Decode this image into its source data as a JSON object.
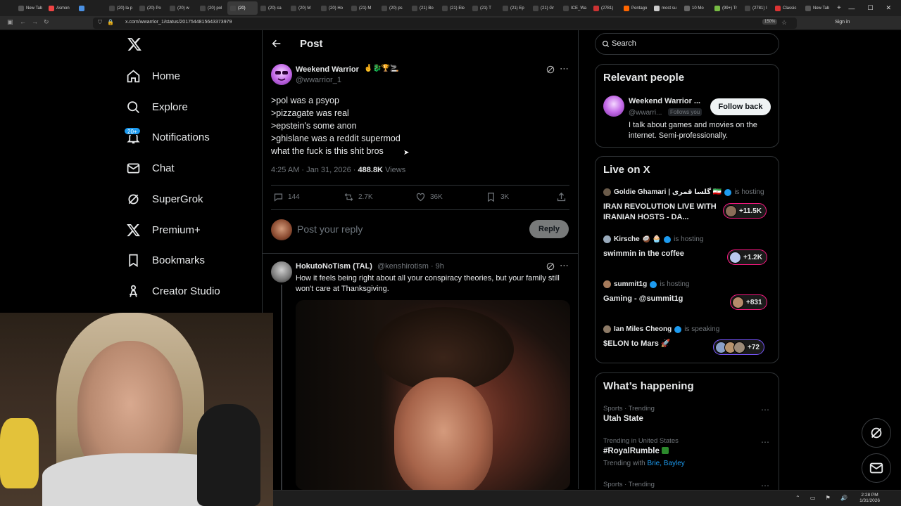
{
  "browser": {
    "tabs": [
      {
        "label": "New Tab"
      },
      {
        "label": "Asmon"
      },
      {
        "label": ""
      },
      {
        "label": "(20) la p"
      },
      {
        "label": "(20) Po"
      },
      {
        "label": "(20) w"
      },
      {
        "label": "(20) pol"
      },
      {
        "label": "(20)"
      },
      {
        "label": "(20) ca"
      },
      {
        "label": "(20) M"
      },
      {
        "label": "(20) Ho"
      },
      {
        "label": "(21) M"
      },
      {
        "label": "(20) ps"
      },
      {
        "label": "(21) Bo"
      },
      {
        "label": "(21) Ele"
      },
      {
        "label": "(21) T"
      },
      {
        "label": "(21) Ep"
      },
      {
        "label": "(21) Gr"
      },
      {
        "label": "ICE_Wa"
      },
      {
        "label": "(2781)"
      },
      {
        "label": "Pentago"
      },
      {
        "label": "most su"
      },
      {
        "label": "10 Mo"
      },
      {
        "label": "(99+) Tr"
      },
      {
        "label": "(2781) I"
      },
      {
        "label": "Classic"
      },
      {
        "label": "New Tab"
      }
    ],
    "active_tab_index": 7,
    "url": "x.com/wwarrior_1/status/2017544815643373979",
    "zoom": "150%",
    "sign_in": "Sign in"
  },
  "nav": {
    "items": [
      {
        "label": "Home",
        "icon": "home-icon"
      },
      {
        "label": "Explore",
        "icon": "search-icon"
      },
      {
        "label": "Notifications",
        "icon": "bell-icon"
      },
      {
        "label": "Chat",
        "icon": "mail-icon"
      },
      {
        "label": "SuperGrok",
        "icon": "grok-icon"
      },
      {
        "label": "Premium+",
        "icon": "x-logo-icon"
      },
      {
        "label": "Bookmarks",
        "icon": "bookmark-icon"
      },
      {
        "label": "Creator Studio",
        "icon": "creator-icon"
      }
    ],
    "notif_badge": "20+"
  },
  "post": {
    "header": "Post",
    "author_name": "Weekend Warrior",
    "author_emoji": "🤞🐉🏆🚬",
    "author_handle": "@wwarrior_1",
    "lines": [
      ">pol was a psyop",
      ">pizzagate was real",
      ">epstein's some anon",
      ">ghislane was a reddit supermod",
      "what the fuck is this shit bros"
    ],
    "time": "4:25 AM · Jan 31, 2026 · ",
    "views_count": "488.8K",
    "views_label": " Views",
    "actions": {
      "replies": "144",
      "reposts": "2.7K",
      "likes": "36K",
      "bookmarks": "3K"
    },
    "reply_placeholder": "Post your reply",
    "reply_button": "Reply"
  },
  "reply": {
    "name": "HokutoNoTism (TAL)",
    "handle": "@kenshirotism · 9h",
    "text": "How it feels being right about all your conspiracy theories, but your family still won't care at Thanksgiving."
  },
  "right": {
    "search_placeholder": "Search",
    "relevant": {
      "title": "Relevant people",
      "name": "Weekend Warrior ...",
      "handle": "@wwarri...",
      "follows_you": "Follows you",
      "follow_back": "Follow back",
      "bio": "I talk about games and movies on the internet. Semi-professionally."
    },
    "live": {
      "title": "Live on X",
      "items": [
        {
          "host": "Goldie Ghamari | گلسا قمری 🇮🇷",
          "status": "is hosting",
          "title": "IRAN REVOLUTION LIVE WITH IRANIAN HOSTS - DA...",
          "count": "+11.5K",
          "pill": "pink"
        },
        {
          "host": "Kirsche 🥥 🧁",
          "status": "is hosting",
          "title": "swimmin in the coffee",
          "count": "+1.2K",
          "pill": "pink"
        },
        {
          "host": "summit1g",
          "status": "is hosting",
          "title": "Gaming - @summit1g",
          "count": "+831",
          "pill": "pink"
        },
        {
          "host": "Ian Miles Cheong",
          "status": "is speaking",
          "title": "$ELON to Mars 🚀",
          "count": "+72",
          "pill": "purple"
        }
      ]
    },
    "happening": {
      "title": "What’s happening",
      "trends": [
        {
          "meta": "Sports · Trending",
          "name": "Utah State"
        },
        {
          "meta": "Trending in United States",
          "name": "#RoyalRumble"
        },
        {
          "meta": "Sports · Trending",
          "name": ""
        }
      ],
      "trending_with_label": "Trending with ",
      "trending_with_names": "Brie, Bayley"
    }
  },
  "taskbar": {
    "time": "2:28 PM",
    "date": "1/31/2026"
  }
}
